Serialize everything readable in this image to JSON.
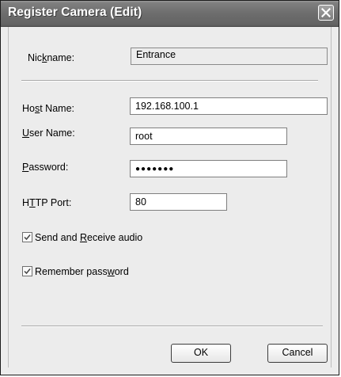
{
  "window": {
    "title": "Register Camera (Edit)",
    "close_icon": "close-icon"
  },
  "form": {
    "nickname": {
      "label_pre": "Nic",
      "label_key": "k",
      "label_post": "name:",
      "value": "Entrance"
    },
    "host_name": {
      "label_pre": "Ho",
      "label_key": "s",
      "label_post": "t Name:",
      "value": "192.168.100.1"
    },
    "user_name": {
      "label_pre": "",
      "label_key": "U",
      "label_post": "ser Name:",
      "value": "root"
    },
    "password": {
      "label_pre": "",
      "label_key": "P",
      "label_post": "assword:",
      "value": "●●●●●●●"
    },
    "http_port": {
      "label_pre": "H",
      "label_key": "T",
      "label_post": "TP Port:",
      "value": "80"
    },
    "send_receive_audio": {
      "label_pre": "Send and ",
      "label_key": "R",
      "label_post": "eceive audio",
      "checked": true
    },
    "remember_password": {
      "label_pre": "Remember pass",
      "label_key": "w",
      "label_post": "ord",
      "checked": true
    }
  },
  "buttons": {
    "ok": "OK",
    "cancel": "Cancel"
  }
}
